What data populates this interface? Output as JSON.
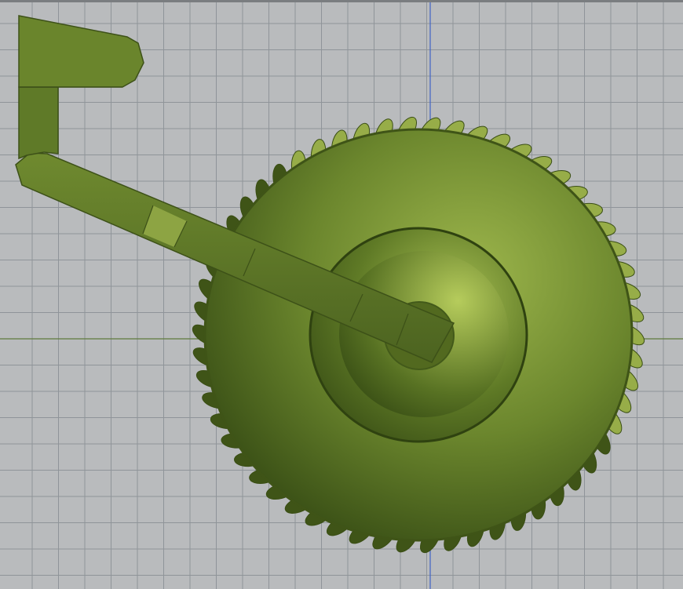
{
  "viewport": {
    "background_color": "#b9bbbd",
    "grid_color": "#8f9499",
    "axis_vertical_color": "#3f63c6",
    "axis_horizontal_color": "#5f7a3c",
    "top_bar_color": "#7a7d80"
  },
  "model": {
    "body_color": "#667f2e",
    "body_light_color": "#97ad48",
    "body_dark_color": "#3f5417",
    "parts": [
      "wheel-tire",
      "wheel-hub",
      "axle-arm",
      "grip-handle"
    ]
  }
}
